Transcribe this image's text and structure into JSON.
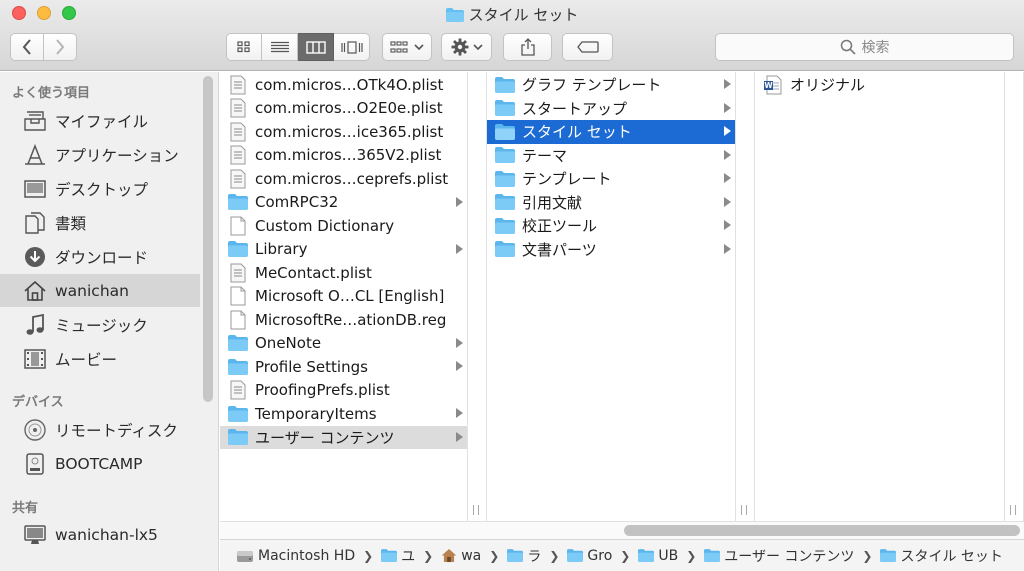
{
  "window": {
    "title": "スタイル セット"
  },
  "toolbar": {
    "search_placeholder": "検索"
  },
  "sidebar": {
    "favorites_label": "よく使う項目",
    "favorites": [
      {
        "label": "マイファイル",
        "icon": "all-my-files-icon"
      },
      {
        "label": "アプリケーション",
        "icon": "applications-icon"
      },
      {
        "label": "デスクトップ",
        "icon": "desktop-icon"
      },
      {
        "label": "書類",
        "icon": "documents-icon"
      },
      {
        "label": "ダウンロード",
        "icon": "downloads-icon"
      },
      {
        "label": "wanichan",
        "icon": "home-icon"
      },
      {
        "label": "ミュージック",
        "icon": "music-icon"
      },
      {
        "label": "ムービー",
        "icon": "movies-icon"
      }
    ],
    "devices_label": "デバイス",
    "devices": [
      {
        "label": "リモートディスク",
        "icon": "remote-disc-icon"
      },
      {
        "label": "BOOTCAMP",
        "icon": "disk-icon"
      }
    ],
    "shared_label": "共有",
    "shared": [
      {
        "label": "wanichan-lx5",
        "icon": "computer-icon"
      }
    ]
  },
  "column1": [
    {
      "label": "com.micros…OTk4O.plist",
      "type": "plist"
    },
    {
      "label": "com.micros…O2E0e.plist",
      "type": "plist"
    },
    {
      "label": "com.micros…ice365.plist",
      "type": "plist"
    },
    {
      "label": "com.micros…365V2.plist",
      "type": "plist"
    },
    {
      "label": "com.micros…ceprefs.plist",
      "type": "plist"
    },
    {
      "label": "ComRPC32",
      "type": "folder"
    },
    {
      "label": "Custom Dictionary",
      "type": "file"
    },
    {
      "label": "Library",
      "type": "folder"
    },
    {
      "label": "MeContact.plist",
      "type": "plist"
    },
    {
      "label": "Microsoft O…CL [English]",
      "type": "file"
    },
    {
      "label": "MicrosoftRe…ationDB.reg",
      "type": "file"
    },
    {
      "label": "OneNote",
      "type": "folder"
    },
    {
      "label": "Profile Settings",
      "type": "folder"
    },
    {
      "label": "ProofingPrefs.plist",
      "type": "plist"
    },
    {
      "label": "TemporaryItems",
      "type": "folder"
    },
    {
      "label": "ユーザー コンテンツ",
      "type": "folder"
    }
  ],
  "column2": [
    {
      "label": "グラフ テンプレート"
    },
    {
      "label": "スタートアップ"
    },
    {
      "label": "スタイル セット"
    },
    {
      "label": "テーマ"
    },
    {
      "label": "テンプレート"
    },
    {
      "label": "引用文献"
    },
    {
      "label": "校正ツール"
    },
    {
      "label": "文書パーツ"
    }
  ],
  "column3": [
    {
      "label": "オリジナル",
      "type": "word-document"
    }
  ],
  "pathbar": [
    {
      "label": "Macintosh HD",
      "icon": "hard-drive-icon"
    },
    {
      "label": "ユ",
      "icon": "folder-icon"
    },
    {
      "label": "wa",
      "icon": "home-icon"
    },
    {
      "label": "ラ",
      "icon": "folder-icon"
    },
    {
      "label": "Gro",
      "icon": "folder-icon"
    },
    {
      "label": "UB",
      "icon": "folder-icon"
    },
    {
      "label": "ユーザー コンテンツ",
      "icon": "folder-icon"
    },
    {
      "label": "スタイル セット",
      "icon": "folder-icon"
    }
  ],
  "colors": {
    "selection_blue": "#1c6ad4",
    "selection_gray": "#dcdcdc",
    "folder_blue": "#66bff2"
  }
}
